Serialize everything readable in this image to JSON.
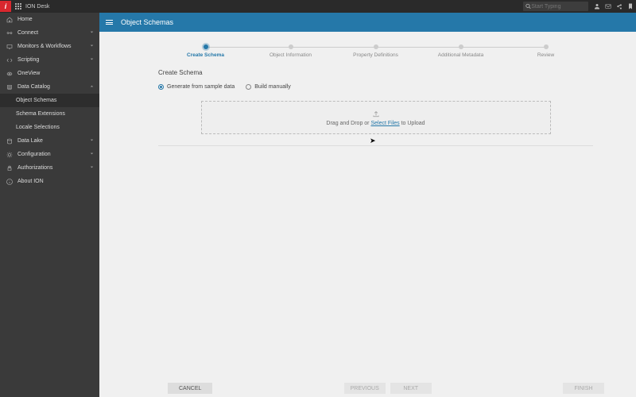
{
  "topbar": {
    "brand_letter": "i",
    "app_title": "ION Desk",
    "search_placeholder": "Start Typing"
  },
  "sidebar": {
    "items": [
      {
        "icon": "home",
        "label": "Home",
        "expandable": false
      },
      {
        "icon": "connect",
        "label": "Connect",
        "expandable": true,
        "expanded": false
      },
      {
        "icon": "monitors",
        "label": "Monitors & Workflows",
        "expandable": true,
        "expanded": false
      },
      {
        "icon": "scripting",
        "label": "Scripting",
        "expandable": true,
        "expanded": false
      },
      {
        "icon": "oneview",
        "label": "OneView",
        "expandable": false
      },
      {
        "icon": "catalog",
        "label": "Data Catalog",
        "expandable": true,
        "expanded": true,
        "children": [
          {
            "label": "Object Schemas",
            "selected": true
          },
          {
            "label": "Schema Extensions"
          },
          {
            "label": "Locale Selections"
          }
        ]
      },
      {
        "icon": "lake",
        "label": "Data Lake",
        "expandable": true,
        "expanded": false
      },
      {
        "icon": "config",
        "label": "Configuration",
        "expandable": true,
        "expanded": false
      },
      {
        "icon": "auth",
        "label": "Authorizations",
        "expandable": true,
        "expanded": false
      },
      {
        "icon": "about",
        "label": "About ION",
        "expandable": false
      }
    ]
  },
  "main": {
    "title": "Object Schemas",
    "stepper": [
      {
        "label": "Create Schema",
        "active": true
      },
      {
        "label": "Object Information"
      },
      {
        "label": "Property Definitions"
      },
      {
        "label": "Additional Metadata"
      },
      {
        "label": "Review"
      }
    ],
    "section_title": "Create Schema",
    "radios": {
      "generate": "Generate from sample data",
      "build": "Build manually"
    },
    "dropzone": {
      "prefix": "Drag and Drop or ",
      "link": "Select Files",
      "suffix": " to Upload"
    }
  },
  "footer": {
    "cancel": "CANCEL",
    "previous": "PREVIOUS",
    "next": "NEXT",
    "finish": "FINISH"
  }
}
